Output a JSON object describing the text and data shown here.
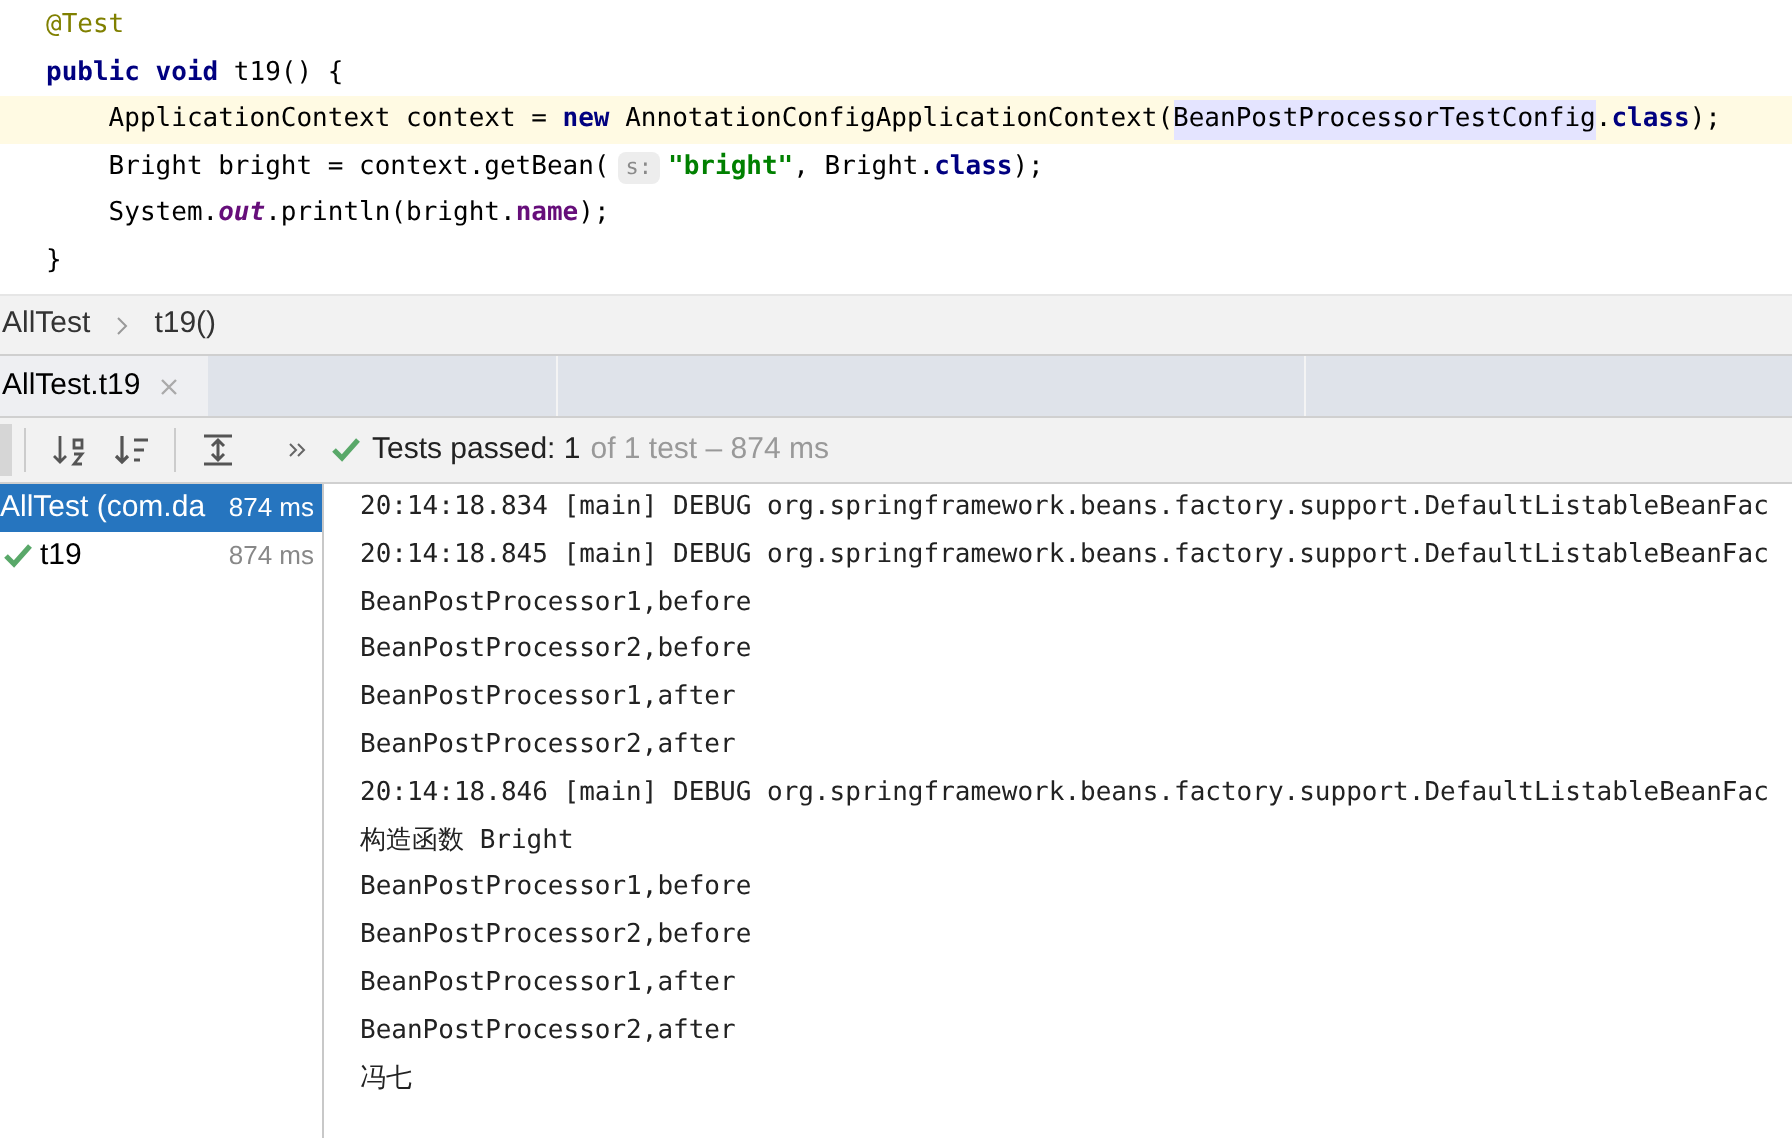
{
  "editor": {
    "lines": [
      {
        "current": false,
        "tokens": [
          {
            "text": "@Test",
            "kind": "annotation"
          }
        ]
      },
      {
        "current": false,
        "tokens": [
          {
            "text": "public void",
            "kind": "keyword"
          },
          {
            "text": " t19() {",
            "kind": "plain"
          }
        ]
      },
      {
        "current": true,
        "tokens": [
          {
            "text": "    ApplicationContext context = ",
            "kind": "plain"
          },
          {
            "text": "new",
            "kind": "keyword"
          },
          {
            "text": " AnnotationConfigApplicationContext(",
            "kind": "plain"
          },
          {
            "text": "BeanPostProcessorTestConfig",
            "kind": "highlight"
          },
          {
            "text": ".",
            "kind": "plain"
          },
          {
            "text": "class",
            "kind": "keyword"
          },
          {
            "text": ");",
            "kind": "plain"
          }
        ]
      },
      {
        "current": false,
        "tokens": [
          {
            "text": "    Bright bright = context.getBean(",
            "kind": "plain"
          },
          {
            "text": "s:",
            "kind": "hint"
          },
          {
            "text": "\"bright\"",
            "kind": "string"
          },
          {
            "text": ", Bright.",
            "kind": "plain"
          },
          {
            "text": "class",
            "kind": "keyword"
          },
          {
            "text": ");",
            "kind": "plain"
          }
        ]
      },
      {
        "current": false,
        "tokens": [
          {
            "text": "    System.",
            "kind": "plain"
          },
          {
            "text": "out",
            "kind": "static"
          },
          {
            "text": ".println(bright.",
            "kind": "plain"
          },
          {
            "text": "name",
            "kind": "field"
          },
          {
            "text": ");",
            "kind": "plain"
          }
        ]
      },
      {
        "current": false,
        "tokens": [
          {
            "text": "}",
            "kind": "plain"
          }
        ]
      }
    ]
  },
  "breadcrumbs": [
    "AllTest",
    "t19()"
  ],
  "tabs": [
    {
      "label": "AllTest.t19",
      "selected": true
    }
  ],
  "toolbar": {
    "status": "Tests passed: 1",
    "detail": "of 1 test – 874 ms"
  },
  "tree": [
    {
      "label": "AllTest (com.da",
      "time": "874 ms",
      "selected": true,
      "passed": false,
      "children": [
        {
          "label": "t19",
          "time": "874 ms",
          "selected": false,
          "passed": true
        }
      ]
    }
  ],
  "console": [
    "20:14:18.834 [main] DEBUG org.springframework.beans.factory.support.DefaultListableBeanFac",
    "20:14:18.845 [main] DEBUG org.springframework.beans.factory.support.DefaultListableBeanFac",
    "BeanPostProcessor1,before",
    "BeanPostProcessor2,before",
    "BeanPostProcessor1,after",
    "BeanPostProcessor2,after",
    "20:14:18.846 [main] DEBUG org.springframework.beans.factory.support.DefaultListableBeanFac",
    "构造函数 Bright",
    "BeanPostProcessor1,before",
    "BeanPostProcessor2,before",
    "BeanPostProcessor1,after",
    "BeanPostProcessor2,after",
    "冯七"
  ]
}
